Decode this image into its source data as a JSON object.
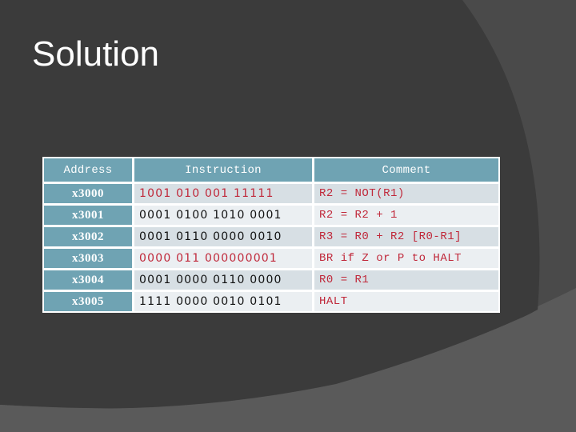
{
  "slide": {
    "title": "Solution"
  },
  "colors": {
    "background_dark": "#3b3b3b",
    "background_mid": "#4a4a4a",
    "background_light": "#5a5a5a",
    "header_fill": "#6fa3b3",
    "row_odd": "#d7dfe4",
    "row_even": "#ebeff2",
    "highlight_text": "#c0283a",
    "normal_text": "#111111"
  },
  "table": {
    "headers": [
      "Address",
      "Instruction",
      "Comment"
    ],
    "rows": [
      {
        "address": "x3000",
        "instruction": "1001 010 001 11111",
        "comment": "R2 = NOT(R1)",
        "highlight": true
      },
      {
        "address": "x3001",
        "instruction": "0001 0100 1010 0001",
        "comment": "R2 = R2 + 1",
        "highlight": false
      },
      {
        "address": "x3002",
        "instruction": "0001 0110 0000 0010",
        "comment": "R3 = R0 + R2 [R0-R1]",
        "highlight": false
      },
      {
        "address": "x3003",
        "instruction": "0000 011 000000001",
        "comment": "BR if Z or P to HALT",
        "highlight": true
      },
      {
        "address": "x3004",
        "instruction": "0001 0000 0110 0000",
        "comment": "R0 = R1",
        "highlight": false
      },
      {
        "address": "x3005",
        "instruction": "1111 0000 0010 0101",
        "comment": "HALT",
        "highlight": false
      }
    ]
  }
}
